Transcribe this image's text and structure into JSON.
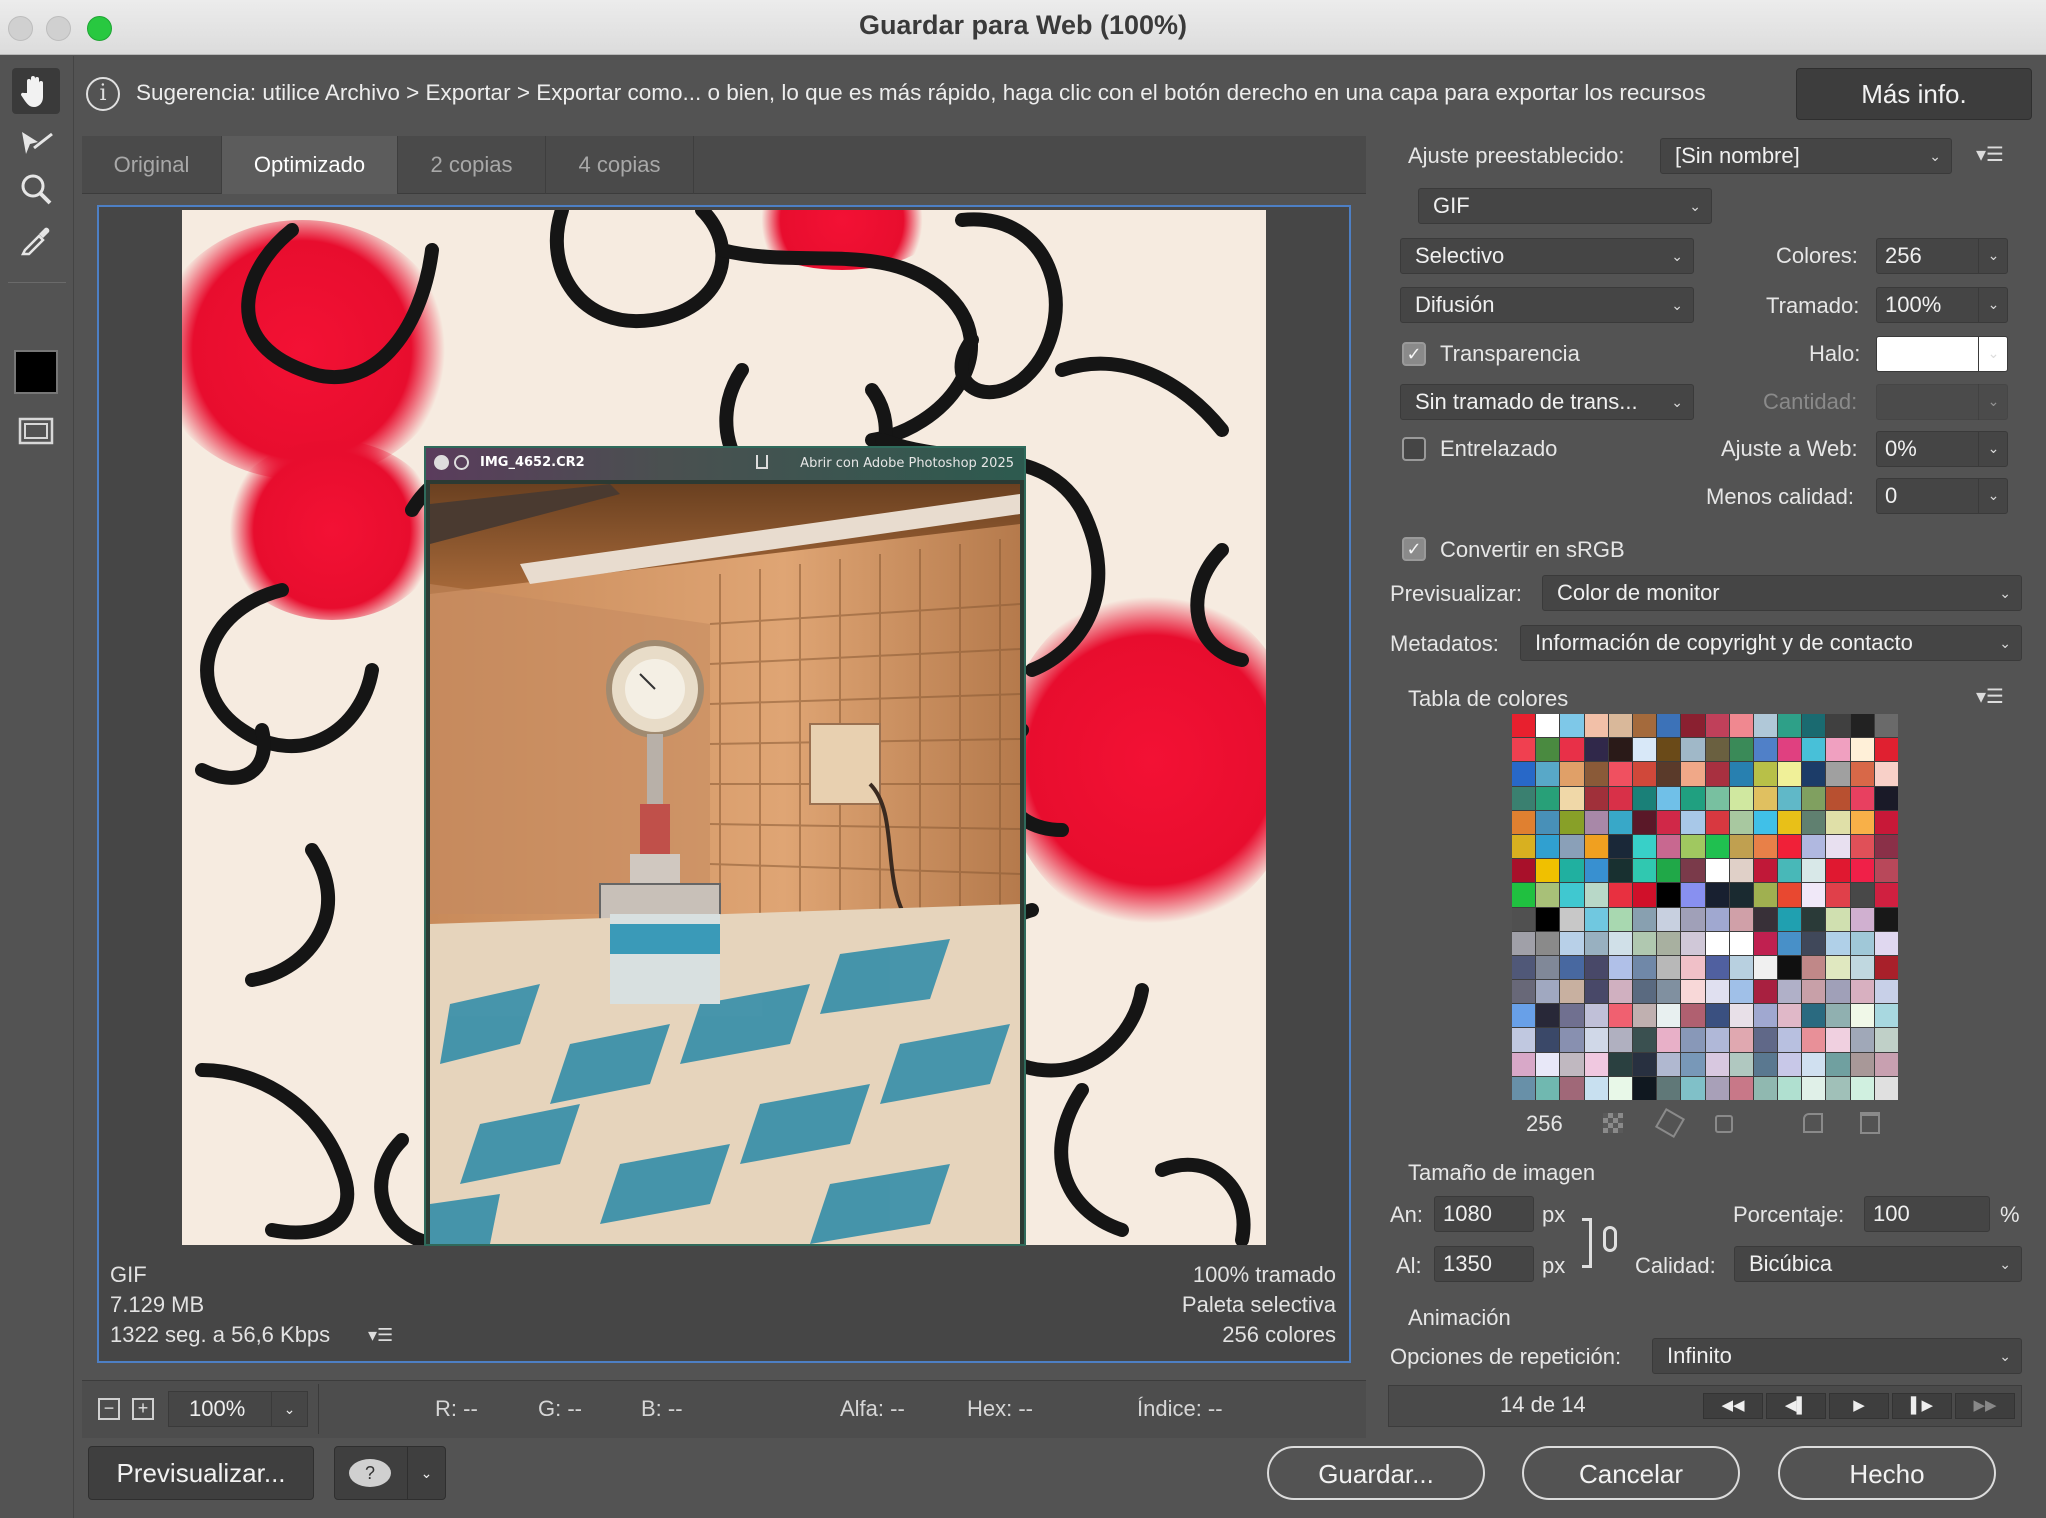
{
  "window": {
    "title": "Guardar para Web (100%)"
  },
  "hint": {
    "text": "Sugerencia: utilice Archivo > Exportar > Exportar como... o bien, lo que es más rápido, haga clic con el botón derecho en una capa para exportar los recursos",
    "more_info": "Más info."
  },
  "tools": [
    "hand-tool-icon",
    "slice-select-icon",
    "zoom-icon",
    "eyedropper-icon",
    "color-swatch",
    "toggle-slices-icon"
  ],
  "tabs": [
    {
      "label": "Original"
    },
    {
      "label": "Optimizado"
    },
    {
      "label": "2 copias"
    },
    {
      "label": "4 copias"
    }
  ],
  "preview": {
    "popup_name": "IMG_4652.CR2",
    "popup_open": "Abrir con Adobe Photoshop 2025",
    "format": "GIF",
    "size": "7.129 MB",
    "time": "1322 seg. a 56,6 Kbps",
    "dither": "100% tramado",
    "palette": "Paleta selectiva",
    "colors": "256 colores"
  },
  "statusbar": {
    "zoom": "100%",
    "r": "R: --",
    "g": "G: --",
    "b": "B: --",
    "alpha": "Alfa: --",
    "hex": "Hex: --",
    "index": "Índice: --"
  },
  "buttons": {
    "preview": "Previsualizar...",
    "save": "Guardar...",
    "cancel": "Cancelar",
    "done": "Hecho"
  },
  "settings": {
    "preset_label": "Ajuste preestablecido:",
    "preset_value": "[Sin nombre]",
    "format": "GIF",
    "reduction": "Selectivo",
    "colors_label": "Colores:",
    "colors_value": "256",
    "dither_algo": "Difusión",
    "dither_label": "Tramado:",
    "dither_value": "100%",
    "transparency_label": "Transparencia",
    "transparency_checked": true,
    "matte_label": "Halo:",
    "trans_dither": "Sin tramado de trans...",
    "amount_label": "Cantidad:",
    "interlaced_label": "Entrelazado",
    "interlaced_checked": false,
    "websnap_label": "Ajuste a Web:",
    "websnap_value": "0%",
    "lossy_label": "Menos calidad:",
    "lossy_value": "0",
    "srgb_label": "Convertir en sRGB",
    "srgb_checked": true,
    "preview_label": "Previsualizar:",
    "preview_value": "Color de monitor",
    "metadata_label": "Metadatos:",
    "metadata_value": "Información de copyright y de contacto"
  },
  "color_table": {
    "title": "Tabla de colores",
    "count": "256",
    "swatches": [
      "#e8202e",
      "#ffffff",
      "#7ec8e8",
      "#f2c0a8",
      "#d9b89a",
      "#a46a3c",
      "#3c72b8",
      "#8a2030",
      "#c0405a",
      "#f08890",
      "#b0c8d8",
      "#2ea088",
      "#1a6a70",
      "#404040",
      "#222222",
      "#6a6a6a",
      "#f04050",
      "#4a8a40",
      "#e83048",
      "#30284a",
      "#2a1a18",
      "#d8e8f8",
      "#6a4a18",
      "#a0b8c8",
      "#6a6040",
      "#3a8a58",
      "#5080c8",
      "#e04080",
      "#48c0d8",
      "#f0a0c0",
      "#fff0d8",
      "#e02030",
      "#2868c8",
      "#58a8c8",
      "#e0a068",
      "#8a5a38",
      "#f05060",
      "#d0483a",
      "#5a3a2a",
      "#f0a888",
      "#a83040",
      "#2880b0",
      "#b8c048",
      "#f0f098",
      "#1c3c68",
      "#a0a0a0",
      "#d86848",
      "#f8d0c8",
      "#3a8070",
      "#28a078",
      "#f0d8a8",
      "#a0303a",
      "#d83048",
      "#1a8078",
      "#70c0e8",
      "#20a080",
      "#78c0a0",
      "#d0e8a0",
      "#e0c060",
      "#60b8c8",
      "#80a060",
      "#b85030",
      "#e84060",
      "#1a1a28",
      "#e08030",
      "#4890b8",
      "#88a028",
      "#a888a8",
      "#38a8c8",
      "#5a1828",
      "#d02848",
      "#a8c8e8",
      "#d83840",
      "#a8c8a0",
      "#40c0e8",
      "#e8c018",
      "#608070",
      "#e0e0a8",
      "#f8b048",
      "#c81838",
      "#d8b020",
      "#30a0d0",
      "#8aa0b8",
      "#f0a020",
      "#1a2838",
      "#38d0c8",
      "#c86890",
      "#a0c860",
      "#20c050",
      "#c0a050",
      "#e88048",
      "#f02038",
      "#b0b8e0",
      "#e8e0f0",
      "#e05058",
      "#8a3048",
      "#a8102a",
      "#f0c000",
      "#20b0a0",
      "#3890d0",
      "#183030",
      "#30c8b0",
      "#20a848",
      "#7a3a4a",
      "#ffffff",
      "#e0d0c8",
      "#c01838",
      "#48b8b8",
      "#d8e8e8",
      "#e01830",
      "#f02048",
      "#b8485a",
      "#20c040",
      "#a8c078",
      "#40c8d0",
      "#b8d8c8",
      "#e83040",
      "#d0102a",
      "#000000",
      "#8890f0",
      "#182030",
      "#1a2a30",
      "#a0b050",
      "#e84830",
      "#f0e8f8",
      "#e0404a",
      "#484848",
      "#d02040",
      "#505050",
      "#000000",
      "#c8c8c8",
      "#70c8e0",
      "#a8d8b0",
      "#88a0b0",
      "#c8d0e0",
      "#a0a0b8",
      "#a0a8d0",
      "#d0a0a8",
      "#383038",
      "#20a0b0",
      "#2a3a38",
      "#d0e0b0",
      "#d0b0d0",
      "#181818",
      "#a0a0a8",
      "#8a8a8a",
      "#b8d0e8",
      "#98b0c0",
      "#d0e0e8",
      "#b0c8b0",
      "#a8b0a0",
      "#d0c8d8",
      "#ffffff",
      "#ffffff",
      "#c02050",
      "#4890c8",
      "#40485a",
      "#b0d0e8",
      "#a0c8d8",
      "#e0d8f0",
      "#505878",
      "#808898",
      "#4868a0",
      "#484868",
      "#b0c0e8",
      "#7088a8",
      "#b8b8b8",
      "#f0c0c8",
      "#5060a0",
      "#b8d0e0",
      "#f0f0f0",
      "#101010",
      "#c08888",
      "#e0e8c0",
      "#c0d8e0",
      "#a8202a",
      "#686878",
      "#a0a8c0",
      "#c8b0a0",
      "#484868",
      "#d0b0c0",
      "#5a6a80",
      "#8090a0",
      "#f8d8d8",
      "#e0e0f0",
      "#a0c0e8",
      "#a82040",
      "#b0b0c8",
      "#c8a0a8",
      "#a0a0b8",
      "#d8b0c0",
      "#c8d0e8",
      "#68a0e8",
      "#282838",
      "#707090",
      "#c0c0d8",
      "#f06070",
      "#c0b0b0",
      "#e8f0f0",
      "#b06070",
      "#3a5080",
      "#e8e0e8",
      "#a0a8d0",
      "#e0b8c8",
      "#2a6a80",
      "#90b0b0",
      "#f0f8e8",
      "#a8d8e0",
      "#c0c8e0",
      "#3a4868",
      "#8890b0",
      "#d0d8e8",
      "#b0b0c0",
      "#3a5050",
      "#e8b0c8",
      "#8898b8",
      "#b0b8d8",
      "#e0a8b0",
      "#606888",
      "#b8c0e0",
      "#e89098",
      "#f0d0e0",
      "#a0a8b8",
      "#c0d0c8",
      "#d8a8c8",
      "#e8e8f8",
      "#c0b8c0",
      "#f0c8e0",
      "#2a4040",
      "#283040",
      "#b0b8d0",
      "#7898b8",
      "#d8c8e0",
      "#b0c8c0",
      "#5a7890",
      "#c8c8e8",
      "#d0e0f0",
      "#70a0a0",
      "#a89898",
      "#c8a0b0",
      "#6890a8",
      "#70b8b0",
      "#a06878",
      "#c8e0f0",
      "#e8f8e8",
      "#101820",
      "#607878",
      "#80c0c8",
      "#a8a0b8",
      "#c87888",
      "#90b8b0",
      "#b0e0d0",
      "#e0f0e8",
      "#a0c0b8",
      "#d0f0e0",
      "#e0e0e0"
    ]
  },
  "image_size": {
    "title": "Tamaño de imagen",
    "width_label": "An:",
    "width": "1080",
    "height_label": "Al:",
    "height": "1350",
    "unit": "px",
    "percent_label": "Porcentaje:",
    "percent": "100",
    "percent_unit": "%",
    "quality_label": "Calidad:",
    "quality": "Bicúbica"
  },
  "animation": {
    "title": "Animación",
    "loop_label": "Opciones de repetición:",
    "loop_value": "Infinito",
    "frame": "14 de 14"
  }
}
